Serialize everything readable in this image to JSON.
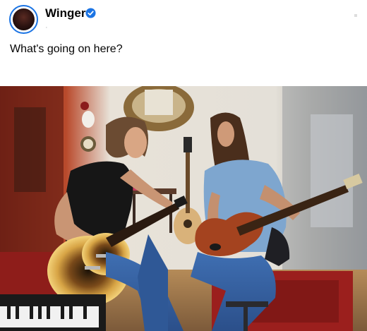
{
  "post": {
    "author": "Winger",
    "verified_icon": "verified-badge-icon",
    "meta": "·",
    "caption": "What's going on here?",
    "photo_icon": "photo-image",
    "colors": {
      "verified": "#1b74e4",
      "text": "#050505",
      "muted": "#b0b3b8"
    }
  }
}
